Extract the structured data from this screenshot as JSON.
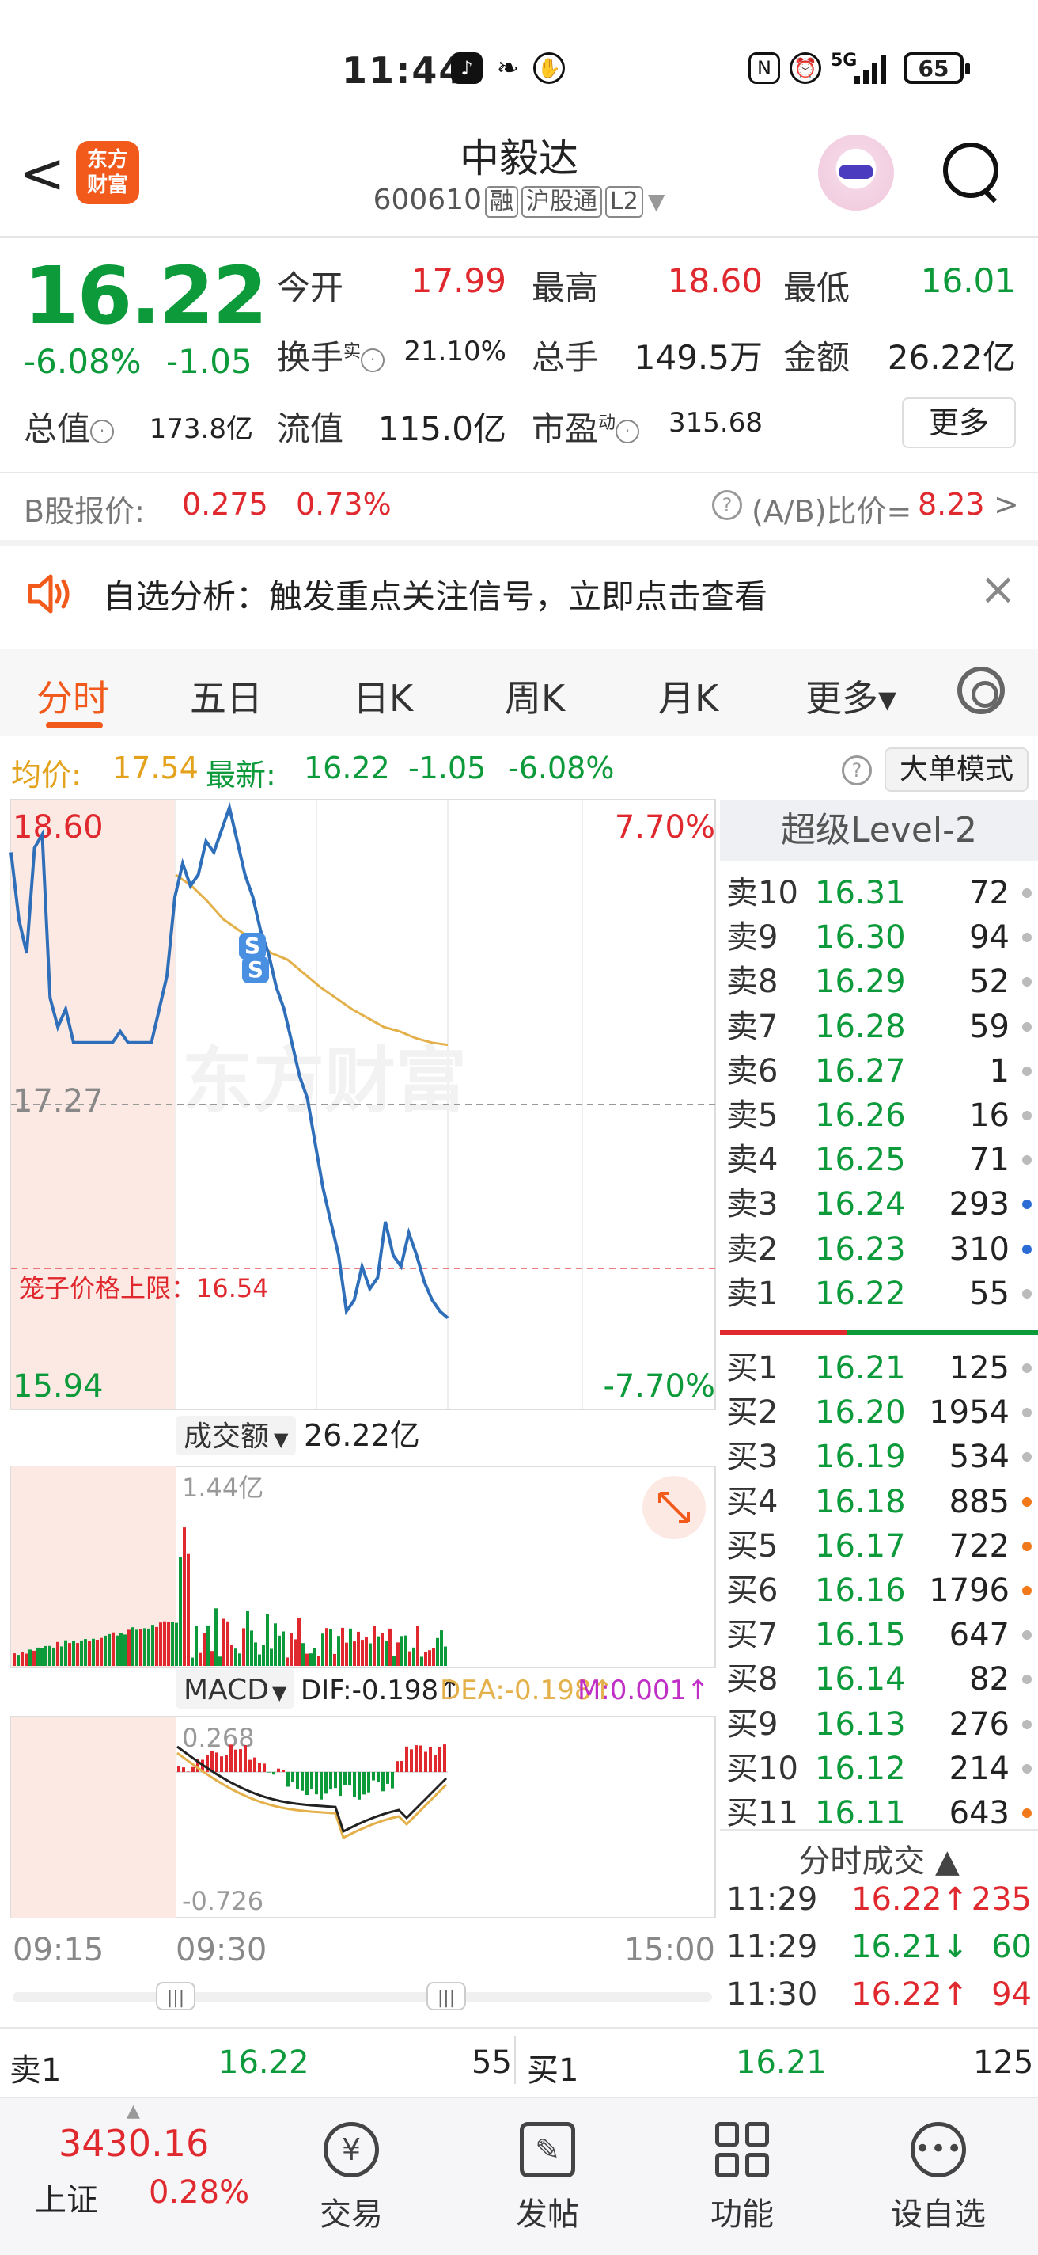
{
  "status_bar": {
    "time": "11:44",
    "battery": "65",
    "network": "5G"
  },
  "header": {
    "logo_text": "东方\n财富",
    "stock_name": "中毅达",
    "stock_code": "600610",
    "tags": [
      "融",
      "沪股通",
      "L2"
    ]
  },
  "quote": {
    "price": "16.22",
    "change_pct": "-6.08%",
    "change": "-1.05",
    "open_label": "今开",
    "open": "17.99",
    "high_label": "最高",
    "high": "18.60",
    "low_label": "最低",
    "low": "16.01",
    "turnover_label": "换手",
    "turnover_sup": "实",
    "turnover": "21.10%",
    "volume_label": "总手",
    "volume": "149.5万",
    "amount_label": "金额",
    "amount": "26.22亿",
    "mktcap_label": "总值",
    "mktcap": "173.8亿",
    "float_label": "流值",
    "float": "115.0亿",
    "pe_label": "市盈",
    "pe_sup": "动",
    "pe": "315.68",
    "more_label": "更多"
  },
  "b_share": {
    "label": "B股报价:",
    "price": "0.275",
    "pct": "0.73%",
    "ratio_label": "(A/B)比价=",
    "ratio": "8.23",
    "arrow": ">"
  },
  "alert": {
    "text": "自选分析：触发重点关注信号，立即点击查看"
  },
  "tabs": [
    {
      "label": "分时",
      "active": true
    },
    {
      "label": "五日"
    },
    {
      "label": "日K"
    },
    {
      "label": "周K"
    },
    {
      "label": "月K"
    },
    {
      "label": "更多▾"
    }
  ],
  "infobar": {
    "avg_label": "均价:",
    "avg": "17.54",
    "latest_label": "最新:",
    "latest": "16.22",
    "chg": "-1.05",
    "pct": "-6.08%",
    "big_order": "大单模式"
  },
  "chart_data": {
    "type": "line",
    "price_top": "18.60",
    "price_mid": "17.27",
    "price_bottom": "15.94",
    "pct_top": "7.70%",
    "pct_bottom": "-7.70%",
    "cage_label": "笼子价格上限：16.54",
    "volume_label": "成交额",
    "volume_total": "26.22亿",
    "volume_max": "1.44亿",
    "macd_label": "MACD",
    "dif": "DIF:-0.198↑",
    "dea": "DEA:-0.198↑",
    "m": "M:0.001↑",
    "macd_top": "0.268",
    "macd_bottom": "-0.726",
    "time_start": "09:15",
    "time_open": "09:30",
    "time_end": "15:00",
    "watermark": "东方财富",
    "ylim": [
      15.94,
      18.6
    ],
    "price_series": [
      18.4,
      18.1,
      17.95,
      18.42,
      18.48,
      17.75,
      17.62,
      17.7,
      17.55,
      17.55,
      17.55,
      17.55,
      17.55,
      17.55,
      17.6,
      17.55,
      17.55,
      17.55,
      17.55,
      17.7,
      17.85,
      18.2,
      18.35,
      18.25,
      18.3,
      18.45,
      18.4,
      18.5,
      18.6,
      18.45,
      18.3,
      18.2,
      18.05,
      17.95,
      17.8,
      17.7,
      17.55,
      17.4,
      17.3,
      17.1,
      16.9,
      16.75,
      16.6,
      16.35,
      16.4,
      16.55,
      16.45,
      16.5,
      16.75,
      16.6,
      16.55,
      16.7,
      16.6,
      16.48,
      16.4,
      16.35,
      16.32
    ],
    "avg_series": [
      18.3,
      18.25,
      18.18,
      18.1,
      18.05,
      18.0,
      17.95,
      17.92,
      17.86,
      17.8,
      17.75,
      17.7,
      17.66,
      17.62,
      17.6,
      17.57,
      17.55,
      17.54
    ]
  },
  "order_book": {
    "title": "超级Level-2",
    "asks": [
      {
        "label": "卖10",
        "price": "16.31",
        "vol": "72",
        "dot": "gray"
      },
      {
        "label": "卖9",
        "price": "16.30",
        "vol": "94",
        "dot": "gray"
      },
      {
        "label": "卖8",
        "price": "16.29",
        "vol": "52",
        "dot": "gray"
      },
      {
        "label": "卖7",
        "price": "16.28",
        "vol": "59",
        "dot": "gray"
      },
      {
        "label": "卖6",
        "price": "16.27",
        "vol": "1",
        "dot": "gray"
      },
      {
        "label": "卖5",
        "price": "16.26",
        "vol": "16",
        "dot": "gray"
      },
      {
        "label": "卖4",
        "price": "16.25",
        "vol": "71",
        "dot": "gray"
      },
      {
        "label": "卖3",
        "price": "16.24",
        "vol": "293",
        "dot": "blue"
      },
      {
        "label": "卖2",
        "price": "16.23",
        "vol": "310",
        "dot": "blue"
      },
      {
        "label": "卖1",
        "price": "16.22",
        "vol": "55",
        "dot": "gray"
      }
    ],
    "bids": [
      {
        "label": "买1",
        "price": "16.21",
        "vol": "125",
        "dot": "gray"
      },
      {
        "label": "买2",
        "price": "16.20",
        "vol": "1954",
        "dot": "gray"
      },
      {
        "label": "买3",
        "price": "16.19",
        "vol": "534",
        "dot": "gray"
      },
      {
        "label": "买4",
        "price": "16.18",
        "vol": "885",
        "dot": "orange"
      },
      {
        "label": "买5",
        "price": "16.17",
        "vol": "722",
        "dot": "orange"
      },
      {
        "label": "买6",
        "price": "16.16",
        "vol": "1796",
        "dot": "orange"
      },
      {
        "label": "买7",
        "price": "16.15",
        "vol": "647",
        "dot": "gray"
      },
      {
        "label": "买8",
        "price": "16.14",
        "vol": "82",
        "dot": "gray"
      },
      {
        "label": "买9",
        "price": "16.13",
        "vol": "276",
        "dot": "gray"
      },
      {
        "label": "买10",
        "price": "16.12",
        "vol": "214",
        "dot": "gray"
      },
      {
        "label": "买11",
        "price": "16.11",
        "vol": "643",
        "dot": "orange"
      }
    ],
    "trades_title": "分时成交 ▲",
    "trades": [
      {
        "time": "11:29",
        "price": "16.22↑",
        "vol": "235",
        "dir": "up"
      },
      {
        "time": "11:29",
        "price": "16.21↓",
        "vol": "60",
        "dir": "down"
      },
      {
        "time": "11:30",
        "price": "16.22↑",
        "vol": "94",
        "dir": "up"
      }
    ]
  },
  "bottom_book": {
    "ask_label": "卖1",
    "ask_price": "16.22",
    "ask_vol": "55",
    "bid_label": "买1",
    "bid_price": "16.21",
    "bid_vol": "125"
  },
  "nav": {
    "index_value": "3430.16",
    "index_name": "上证",
    "index_pct": "0.28%",
    "items": [
      "交易",
      "发帖",
      "功能",
      "设自选"
    ]
  }
}
